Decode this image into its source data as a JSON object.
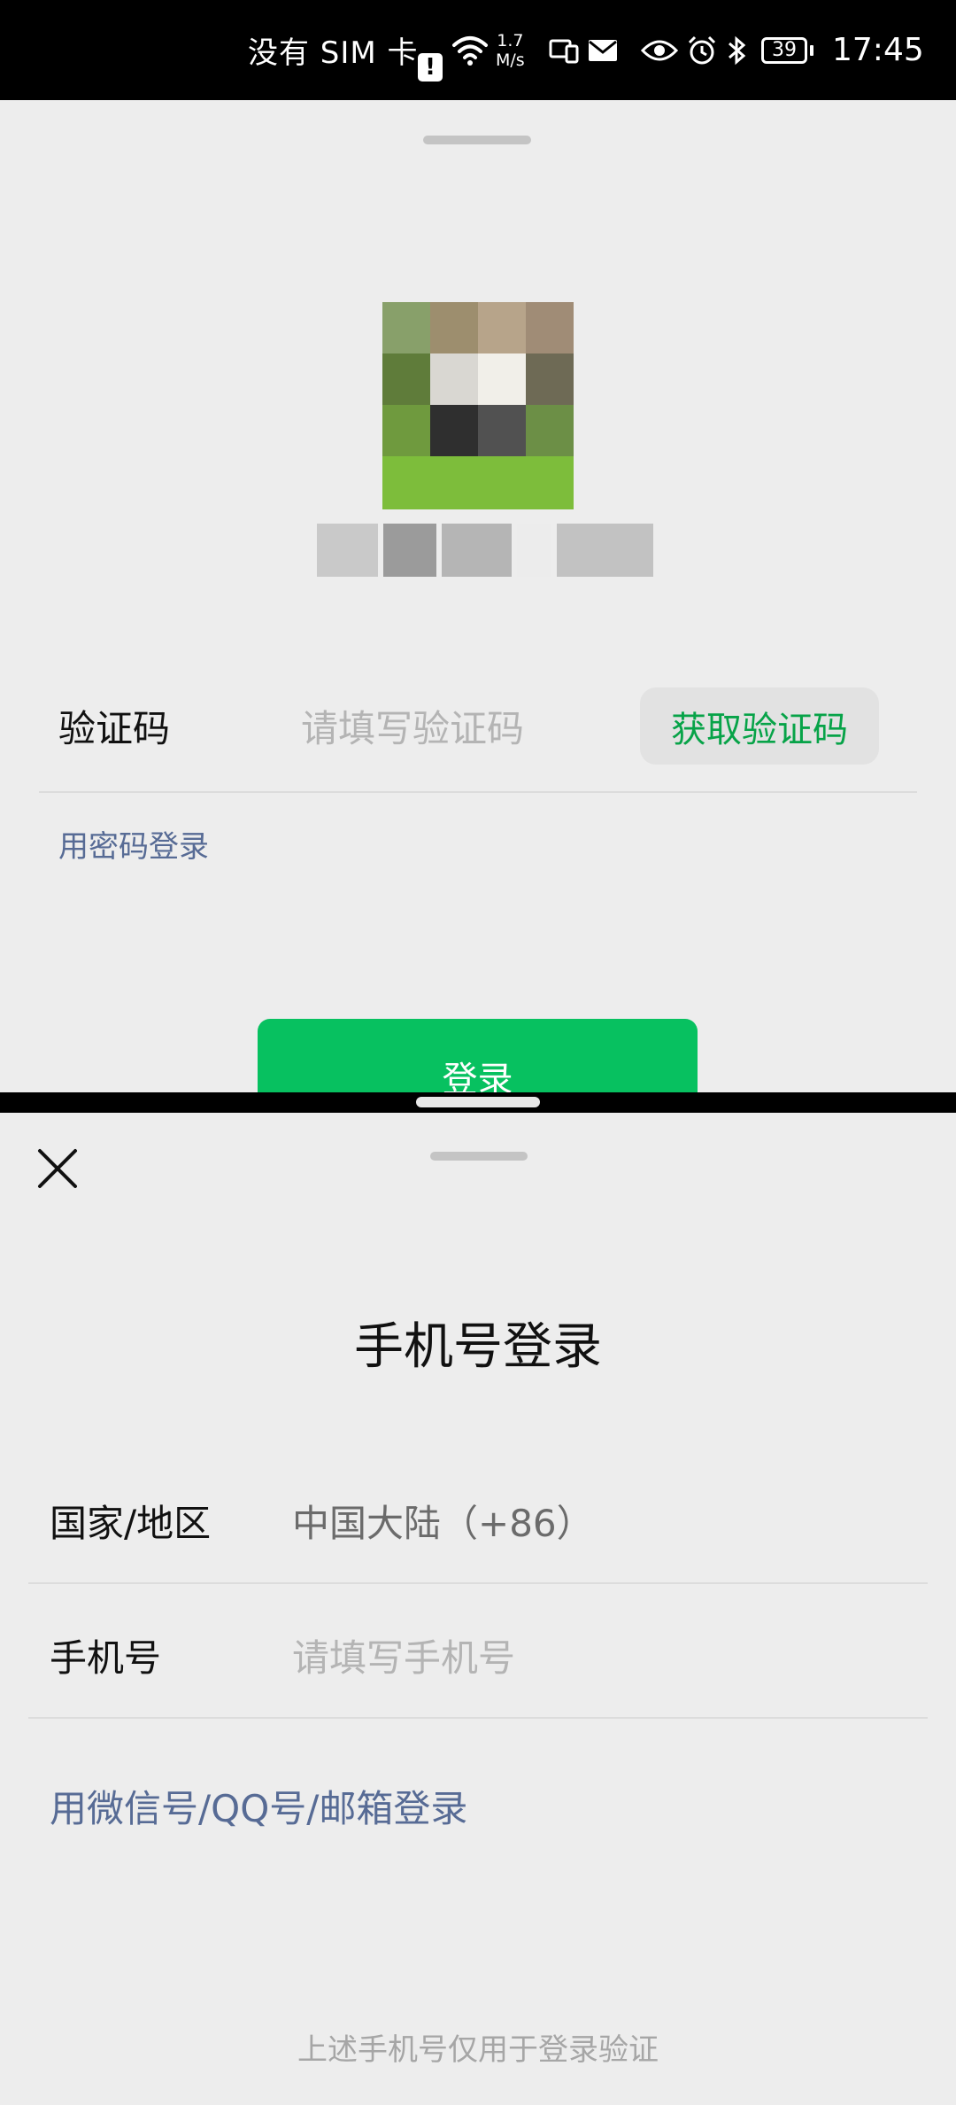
{
  "status_bar": {
    "carrier": "没有 SIM 卡",
    "warning_icon_glyph": "!",
    "network_speed_value": "1.7",
    "network_speed_unit": "M/s",
    "battery_level": "39",
    "time": "17:45",
    "icons": [
      "sim-warning-icon",
      "wifi-icon",
      "screencast-icon",
      "mail-icon",
      "eye-comfort-icon",
      "alarm-icon",
      "bluetooth-icon",
      "battery-icon"
    ]
  },
  "top_pane": {
    "avatar_icon": "avatar-image-pixelated",
    "code_label": "验证码",
    "code_placeholder": "请填写验证码",
    "get_code_button": "获取验证码",
    "password_login_link": "用密码登录",
    "login_button": "登录"
  },
  "bottom_pane": {
    "close_icon": "close-icon",
    "title": "手机号登录",
    "region_label": "国家/地区",
    "region_value": "中国大陆（+86）",
    "phone_label": "手机号",
    "phone_placeholder": "请填写手机号",
    "alt_login_link": "用微信号/QQ号/邮箱登录",
    "footer_note": "上述手机号仅用于登录验证"
  },
  "colors": {
    "accent_green": "#07c160",
    "link_blue": "#576b95",
    "code_button_text": "#07a348",
    "background": "#ededed"
  }
}
